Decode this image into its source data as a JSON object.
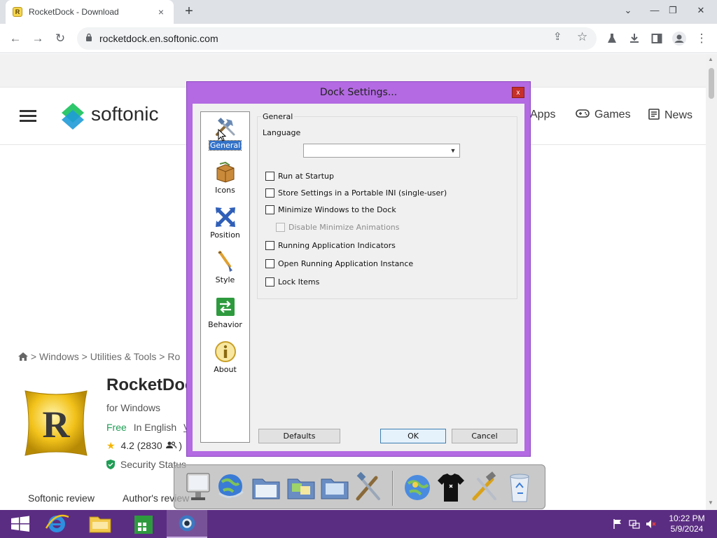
{
  "browser": {
    "tab_title": "RocketDock - Download",
    "favicon_letter": "R",
    "url": "rocketdock.en.softonic.com",
    "tab_close": "×",
    "new_tab": "+",
    "win_controls": {
      "minimize": "—",
      "restore": "❐",
      "close": "✕",
      "tab_search": "⌄"
    },
    "nav": {
      "back": "←",
      "forward": "→",
      "reload": "↻"
    }
  },
  "site": {
    "logo_text": "softonic",
    "nav": [
      {
        "label": "Apps",
        "icon": "apps-icon"
      },
      {
        "label": "Games",
        "icon": "gamepad-icon"
      },
      {
        "label": "News",
        "icon": "news-icon"
      }
    ],
    "breadcrumb": {
      "sep": ">",
      "items": [
        "Windows",
        "Utilities & Tools",
        "Ro"
      ]
    },
    "app": {
      "title": "RocketDock",
      "platform": "for Windows",
      "license": "Free",
      "language": "In English",
      "language_more": "V",
      "rating": "4.2 (2830",
      "rating_close": ")",
      "security": "Security Status"
    },
    "review_tabs": [
      "Softonic review",
      "Author's review"
    ]
  },
  "dialog": {
    "title": "Dock Settings...",
    "close": "x",
    "nav_items": [
      {
        "label": "General",
        "icon": "tools-icon",
        "selected": true
      },
      {
        "label": "Icons",
        "icon": "box-icon",
        "selected": false
      },
      {
        "label": "Position",
        "icon": "arrows-icon",
        "selected": false
      },
      {
        "label": "Style",
        "icon": "paintbrush-icon",
        "selected": false
      },
      {
        "label": "Behavior",
        "icon": "behavior-icon",
        "selected": false
      },
      {
        "label": "About",
        "icon": "info-icon",
        "selected": false
      }
    ],
    "group_title": "General",
    "language_label": "Language",
    "language_value": "",
    "checkboxes": [
      {
        "label": "Run at Startup",
        "checked": false,
        "enabled": true
      },
      {
        "label": "Store Settings in a Portable INI (single-user)",
        "checked": false,
        "enabled": true
      },
      {
        "label": "Minimize Windows to the Dock",
        "checked": false,
        "enabled": true
      },
      {
        "label": "Disable Minimize Animations",
        "checked": false,
        "enabled": false
      },
      {
        "label": "Running Application Indicators",
        "checked": false,
        "enabled": true
      },
      {
        "label": "Open Running Application Instance",
        "checked": false,
        "enabled": true
      },
      {
        "label": "Lock Items",
        "checked": false,
        "enabled": true
      }
    ],
    "buttons": {
      "defaults": "Defaults",
      "ok": "OK",
      "cancel": "Cancel"
    }
  },
  "dock": {
    "items": [
      "monitor-icon",
      "globe-icon",
      "folder-icon",
      "folder-icon",
      "folder-icon",
      "tools-icon",
      "globe-icon",
      "tshirt-icon",
      "tools-icon",
      "recycle-bin-icon"
    ]
  },
  "taskbar": {
    "items": [
      "start-icon",
      "internet-explorer-icon",
      "file-explorer-icon",
      "store-icon",
      "rocketdock-icon"
    ],
    "time": "10:22 PM",
    "date": "5/9/2024"
  },
  "colors": {
    "dialog_frame": "#b36ae2",
    "taskbar": "#5b2d82",
    "softonic_free": "#1f9d55",
    "selection": "#3271c8"
  }
}
